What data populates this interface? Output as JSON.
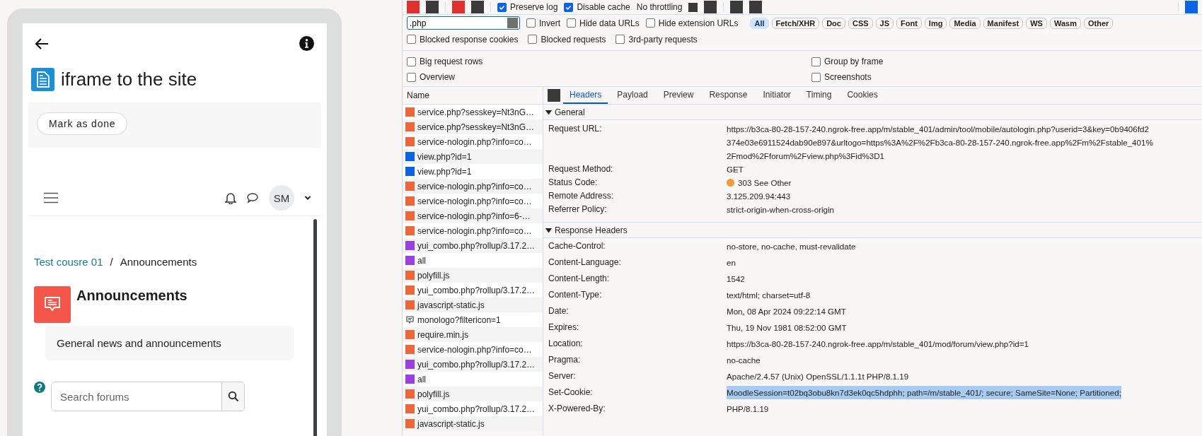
{
  "app": {
    "title": "iframe to the site",
    "mark_done_button": "Mark as done",
    "avatar_initials": "SM",
    "breadcrumb": {
      "link": "Test cousre 01",
      "separator": "/",
      "current": "Announcements"
    },
    "forum": {
      "heading": "Announcements",
      "description": "General news and announcements"
    },
    "search": {
      "placeholder": "Search forums"
    }
  },
  "devtools": {
    "toolbar": {
      "options": [
        {
          "label": "Preserve log",
          "checked": true
        },
        {
          "label": "Disable cache",
          "checked": true
        }
      ],
      "throttling": "No throttling"
    },
    "filter": {
      "value": ".php",
      "options": [
        {
          "label": "Invert",
          "checked": false
        },
        {
          "label": "Hide data URLs",
          "checked": false
        },
        {
          "label": "Hide extension URLs",
          "checked": false
        }
      ]
    },
    "type_filters": [
      {
        "label": "All",
        "selected": true
      },
      {
        "label": "Fetch/XHR",
        "selected": false
      },
      {
        "label": "Doc",
        "selected": false
      },
      {
        "label": "CSS",
        "selected": false
      },
      {
        "label": "JS",
        "selected": false
      },
      {
        "label": "Font",
        "selected": false
      },
      {
        "label": "Img",
        "selected": false
      },
      {
        "label": "Media",
        "selected": false
      },
      {
        "label": "Manifest",
        "selected": false
      },
      {
        "label": "WS",
        "selected": false
      },
      {
        "label": "Wasm",
        "selected": false
      },
      {
        "label": "Other",
        "selected": false
      }
    ],
    "blocked_options": [
      {
        "label": "Blocked response cookies",
        "checked": false
      },
      {
        "label": "Blocked requests",
        "checked": false
      },
      {
        "label": "3rd-party requests",
        "checked": false
      }
    ],
    "settings": [
      {
        "label": "Big request rows",
        "checked": false
      },
      {
        "label": "Group by frame",
        "checked": false
      },
      {
        "label": "Overview",
        "checked": false
      },
      {
        "label": "Screenshots",
        "checked": false
      }
    ],
    "requests": {
      "column": "Name",
      "rows": [
        {
          "name": "service.php?sesskey=Nt3nG…",
          "kind": "script"
        },
        {
          "name": "service.php?sesskey=Nt3nG…",
          "kind": "script"
        },
        {
          "name": "service-nologin.php?info=co…",
          "kind": "script"
        },
        {
          "name": "view.php?id=1",
          "kind": "document"
        },
        {
          "name": "view.php?id=1",
          "kind": "document"
        },
        {
          "name": "service-nologin.php?info=co…",
          "kind": "script"
        },
        {
          "name": "service-nologin.php?info=co…",
          "kind": "script"
        },
        {
          "name": "service-nologin.php?info=6-…",
          "kind": "script"
        },
        {
          "name": "service-nologin.php?info=co…",
          "kind": "script"
        },
        {
          "name": "yui_combo.php?rollup/3.17.2…",
          "kind": "stylesheet"
        },
        {
          "name": "all",
          "kind": "stylesheet"
        },
        {
          "name": "polyfill.js",
          "kind": "script"
        },
        {
          "name": "yui_combo.php?rollup/3.17.2…",
          "kind": "script"
        },
        {
          "name": "javascript-static.js",
          "kind": "script"
        },
        {
          "name": "monologo?filtericon=1",
          "kind": "image"
        },
        {
          "name": "require.min.js",
          "kind": "script"
        },
        {
          "name": "service-nologin.php?info=co…",
          "kind": "script"
        },
        {
          "name": "yui_combo.php?rollup/3.17.2…",
          "kind": "stylesheet"
        },
        {
          "name": "all",
          "kind": "stylesheet"
        },
        {
          "name": "polyfill.js",
          "kind": "script"
        },
        {
          "name": "yui_combo.php?rollup/3.17.2…",
          "kind": "script"
        },
        {
          "name": "javascript-static.js",
          "kind": "script"
        }
      ]
    },
    "detail_tabs": [
      {
        "label": "Headers",
        "selected": true
      },
      {
        "label": "Payload",
        "selected": false
      },
      {
        "label": "Preview",
        "selected": false
      },
      {
        "label": "Response",
        "selected": false
      },
      {
        "label": "Initiator",
        "selected": false
      },
      {
        "label": "Timing",
        "selected": false
      },
      {
        "label": "Cookies",
        "selected": false
      }
    ],
    "sections": [
      {
        "title": "General",
        "expanded": true,
        "rows": [
          {
            "name": "Request URL:",
            "lines": [
              "https://b3ca-80-28-157-240.ngrok-free.app/m/stable_401/admin/tool/mobile/autologin.php?userid=3&key=0b9406fd2",
              "374e03e6911524dab90e897&urltogo=https%3A%2F%2Fb3ca-80-28-157-240.ngrok-free.app%2Fm%2Fstable_401%",
              "2Fmod%2Fforum%2Fview.php%3Fid%3D1"
            ],
            "highlighted": false
          },
          {
            "name": "Request Method:",
            "lines": [
              "GET"
            ],
            "highlighted": false
          },
          {
            "name": "Status Code:",
            "lines": [
              "303 See Other"
            ],
            "color": "#f29a36",
            "highlighted": false
          },
          {
            "name": "Remote Address:",
            "lines": [
              "3.125.209.94:443"
            ],
            "highlighted": false
          },
          {
            "name": "Referrer Policy:",
            "lines": [
              "strict-origin-when-cross-origin"
            ],
            "highlighted": false
          }
        ]
      },
      {
        "title": "Response Headers",
        "expanded": true,
        "rows": [
          {
            "name": "Cache-Control:",
            "lines": [
              "no-store, no-cache, must-revalidate"
            ],
            "highlighted": false
          },
          {
            "name": "Content-Language:",
            "lines": [
              "en"
            ],
            "highlighted": false
          },
          {
            "name": "Content-Length:",
            "lines": [
              "1542"
            ],
            "highlighted": false
          },
          {
            "name": "Content-Type:",
            "lines": [
              "text/html; charset=utf-8"
            ],
            "highlighted": false
          },
          {
            "name": "Date:",
            "lines": [
              "Mon, 08 Apr 2024 09:22:14 GMT"
            ],
            "highlighted": false
          },
          {
            "name": "Expires:",
            "lines": [
              "Thu, 19 Nov 1981 08:52:00 GMT"
            ],
            "highlighted": false
          },
          {
            "name": "Location:",
            "lines": [
              "https://b3ca-80-28-157-240.ngrok-free.app/m/stable_401/mod/forum/view.php?id=1"
            ],
            "highlighted": false
          },
          {
            "name": "Pragma:",
            "lines": [
              "no-cache"
            ],
            "highlighted": false
          },
          {
            "name": "Server:",
            "lines": [
              "Apache/2.4.57 (Unix) OpenSSL/1.1.1t PHP/8.1.19"
            ],
            "highlighted": false
          },
          {
            "name": "Set-Cookie:",
            "lines": [
              "MoodleSession=t02bq3obu8kn7d3ek0qc5hdphh; path=/m/stable_401/; secure; SameSite=None; Partitioned;"
            ],
            "highlighted": true
          },
          {
            "name": "X-Powered-By:",
            "lines": [
              "PHP/8.1.19"
            ],
            "highlighted": false
          }
        ]
      }
    ]
  }
}
